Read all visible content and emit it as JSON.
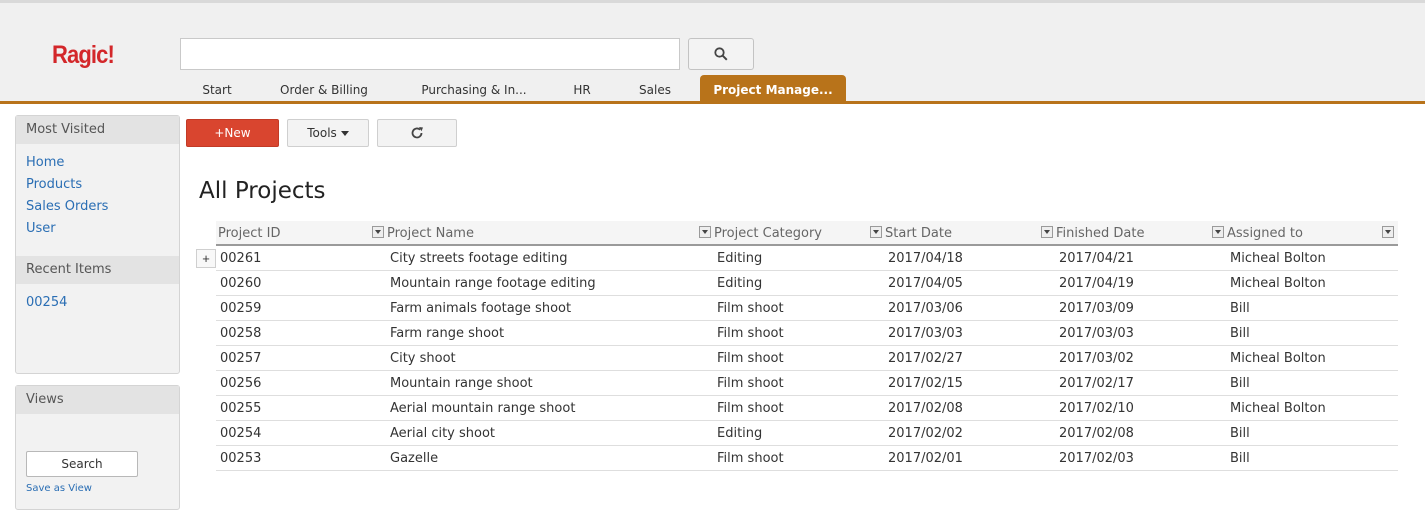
{
  "app": {
    "logo": "Ragic!"
  },
  "search": {
    "placeholder": "",
    "value": "",
    "button_icon": "search-icon"
  },
  "tabs": [
    {
      "label": "Start",
      "active": false
    },
    {
      "label": "Order & Billing",
      "active": false
    },
    {
      "label": "Purchasing & In...",
      "active": false
    },
    {
      "label": "HR",
      "active": false
    },
    {
      "label": "Sales",
      "active": false
    },
    {
      "label": "Project Manage...",
      "active": true
    }
  ],
  "sidebar": {
    "most_visited": {
      "title": "Most Visited",
      "links": [
        "Home",
        "Products",
        "Sales Orders",
        "User"
      ]
    },
    "recent_items": {
      "title": "Recent Items",
      "links": [
        "00254"
      ]
    },
    "views": {
      "title": "Views",
      "search_label": "Search",
      "save_label": "Save as View"
    }
  },
  "toolbar": {
    "new_label": "+New",
    "tools_label": "Tools",
    "refresh_icon": "refresh-icon"
  },
  "page": {
    "title": "All Projects"
  },
  "table": {
    "add_row_label": "+",
    "columns": [
      "Project ID",
      "Project Name",
      "Project Category",
      "Start Date",
      "Finished Date",
      "Assigned to"
    ],
    "rows": [
      [
        "00261",
        "City streets footage editing",
        "Editing",
        "2017/04/18",
        "2017/04/21",
        "Micheal Bolton"
      ],
      [
        "00260",
        "Mountain range footage editing",
        "Editing",
        "2017/04/05",
        "2017/04/19",
        "Micheal Bolton"
      ],
      [
        "00259",
        "Farm animals footage shoot",
        "Film shoot",
        "2017/03/06",
        "2017/03/09",
        "Bill"
      ],
      [
        "00258",
        "Farm range shoot",
        "Film shoot",
        "2017/03/03",
        "2017/03/03",
        "Bill"
      ],
      [
        "00257",
        "City shoot",
        "Film shoot",
        "2017/02/27",
        "2017/03/02",
        "Micheal Bolton"
      ],
      [
        "00256",
        "Mountain range shoot",
        "Film shoot",
        "2017/02/15",
        "2017/02/17",
        "Bill"
      ],
      [
        "00255",
        "Aerial mountain range shoot",
        "Film shoot",
        "2017/02/08",
        "2017/02/10",
        "Micheal Bolton"
      ],
      [
        "00254",
        "Aerial city shoot",
        "Editing",
        "2017/02/02",
        "2017/02/08",
        "Bill"
      ],
      [
        "00253",
        "Gazelle",
        "Film shoot",
        "2017/02/01",
        "2017/02/03",
        "Bill"
      ]
    ]
  },
  "colors": {
    "brand_red": "#d3272a",
    "active_tab": "#b8731a",
    "link": "#2a6eb4",
    "new_button": "#d9452f"
  }
}
